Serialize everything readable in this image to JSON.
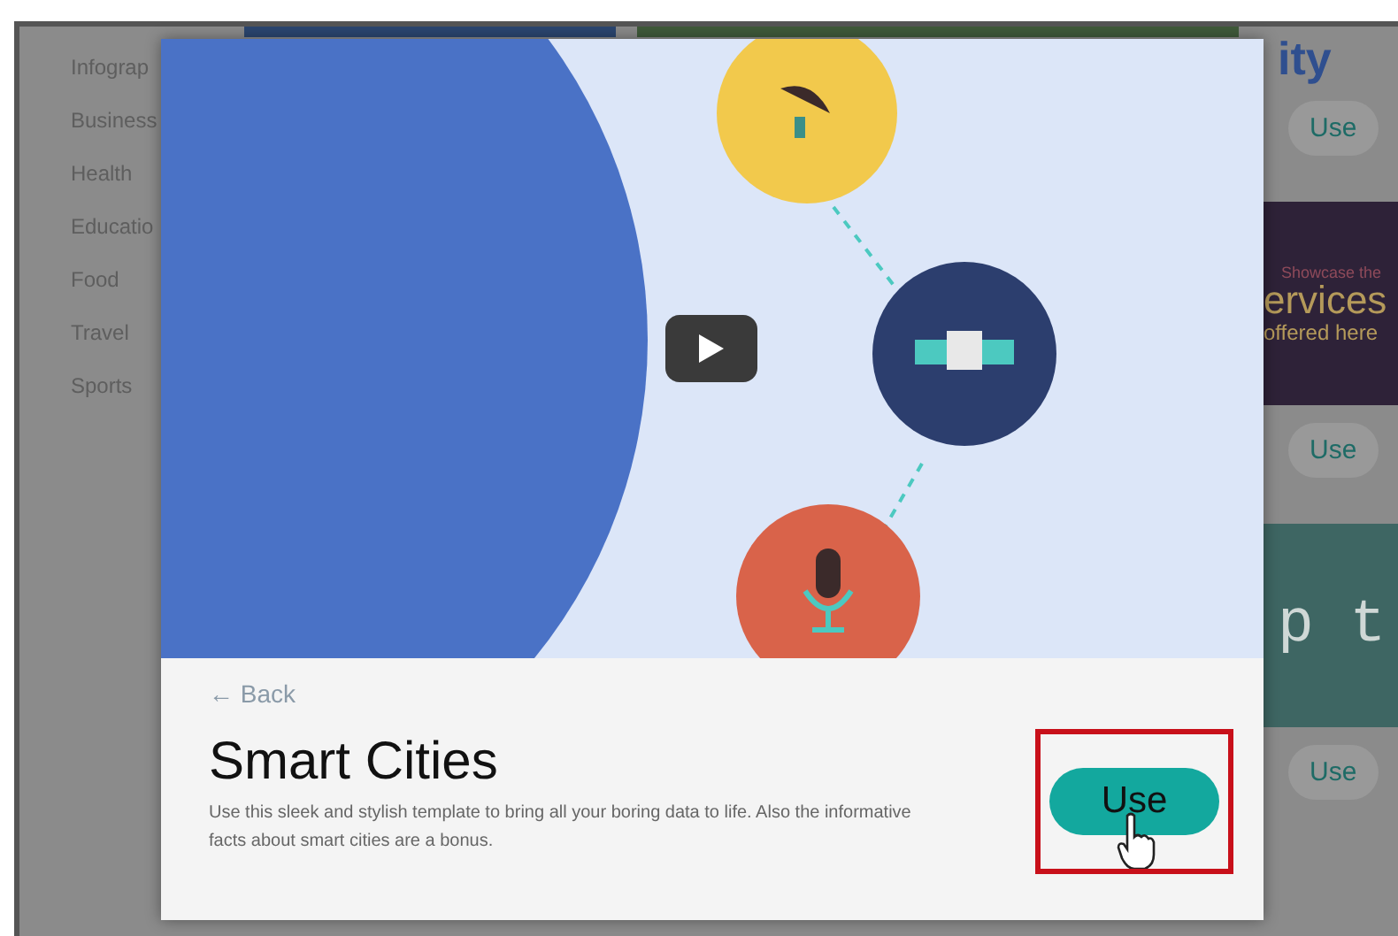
{
  "sidebar": {
    "items": [
      "Infograp",
      "Business",
      "Health",
      "Educatio",
      "Food",
      "Travel",
      "Sports"
    ]
  },
  "thumbnails": [
    {
      "color": "#2b4670"
    },
    {
      "color": "#3f5a3a"
    }
  ],
  "right_column": [
    {
      "kind": "heading",
      "lines": [
        "ity"
      ]
    },
    {
      "kind": "button",
      "lines": [
        "Use"
      ]
    },
    {
      "kind": "banner",
      "color": "#2e2238",
      "lines": [
        "Showcase the",
        "ervices",
        "offered here"
      ]
    },
    {
      "kind": "button",
      "lines": [
        "Use"
      ]
    },
    {
      "kind": "banner",
      "color": "#3e6663",
      "lines": [
        "p t"
      ]
    },
    {
      "kind": "button",
      "lines": [
        "Use"
      ]
    }
  ],
  "modal": {
    "back": "← Back",
    "title": "Smart Cities",
    "description": "Use this sleek and stylish template to bring all your boring data to life. Also the informative facts about smart cities are a bonus.",
    "use_button": "Use",
    "highlighted": true
  }
}
